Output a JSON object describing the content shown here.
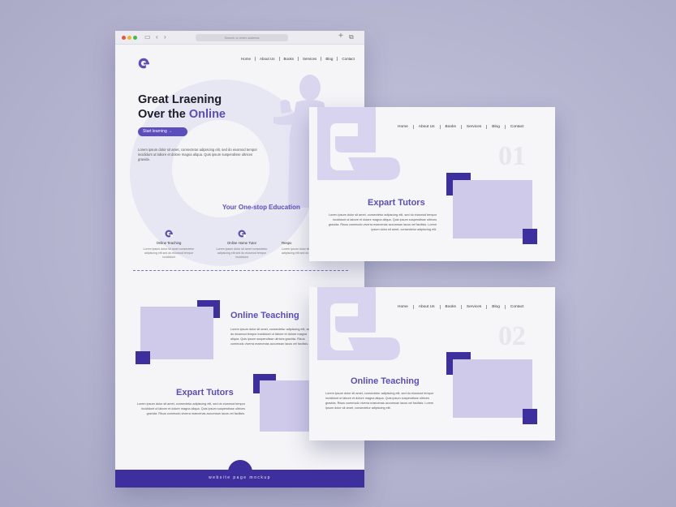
{
  "browser": {
    "address_placeholder": "Search or enter address",
    "nav_back": "‹",
    "nav_forward": "›",
    "new_tab": "+",
    "tabs_icon": "⧉"
  },
  "nav": {
    "items": [
      "Home",
      "About Us",
      "Books",
      "Services",
      "Blog",
      "Contact"
    ]
  },
  "hero": {
    "title_line1": "Great Lraening",
    "title_line2_prefix": "Over the",
    "title_accent": "Online",
    "cta_label": "Start learning  →",
    "text": "Lorem ipsum dolor sit amet, consectetur adipiscing elit, sed do eiusmod tempor incididunt ut labore et dolore magna aliqua. Quis ipsum suspendisse ultrices gravida."
  },
  "services": {
    "title": "Your One-stop Education",
    "features": [
      {
        "title": "Online Teaching",
        "desc": "Lorem ipsum dolor sit amet consectetur adipiscing elit sed do eiusmod tempor incididunt"
      },
      {
        "title": "Online Home Tutor",
        "desc": "Lorem ipsum dolor sit amet consectetur adipiscing elit sed do eiusmod tempor incididunt"
      },
      {
        "title": "Respo",
        "desc": "Lorem ipsum dolor sit amet consectetur adipiscing elit sed do eiusmod"
      }
    ]
  },
  "sections": {
    "online_teaching": {
      "title": "Online Teaching",
      "text": "Lorem ipsum dolor sit amet, consectetur adipiscing elit, sed do eiusmod tempor incididunt ut labore et dolore magna aliqua. Quis ipsum suspendisse ultrices gravida. Risus commodo viverra maecenas accumsan lacus vel facilisis."
    },
    "expart_tutors": {
      "title": "Expart Tutors",
      "text": "Lorem ipsum dolor sit amet, consectetur adipiscing elit, sed do eiusmod tempor incididunt ut labore et dolore magna aliqua. Quis ipsum suspendisse ultrices gravida. Risus commodo viverra maecenas accumsan lacus vel facilisis."
    }
  },
  "footer": {
    "text": "website page mockup"
  },
  "cards": [
    {
      "number": "01",
      "title": "Expart Tutors",
      "text": "Lorem ipsum dolor sit amet, consectetur adipiscing elit, sed do eiusmod tempor incididunt ut labore et dolore magna aliqua. Quis ipsum suspendisse ultrices gravida. Risus commodo viverra maecenas accumsan lacus vel facilisis. Lorem ipsum dolor sit amet, consectetur adipiscing elit."
    },
    {
      "number": "02",
      "title": "Online Teaching",
      "text": "Lorem ipsum dolor sit amet, consectetur adipiscing elit, sed do eiusmod tempor incididunt ut labore et dolore magna aliqua. Quis ipsum suspendisse ultrices gravida. Risus commodo viverra maecenas accumsan lacus vel facilisis. Lorem ipsum dolor sit amet, consectetur adipiscing elit."
    }
  ],
  "colors": {
    "accent": "#5b4dbb",
    "dark_accent": "#3e2f9f",
    "light_block": "#cfcaea",
    "background": "#b5b5d0"
  },
  "icons": {
    "logo": "e-logo-icon",
    "feature": "e-logo-icon"
  }
}
